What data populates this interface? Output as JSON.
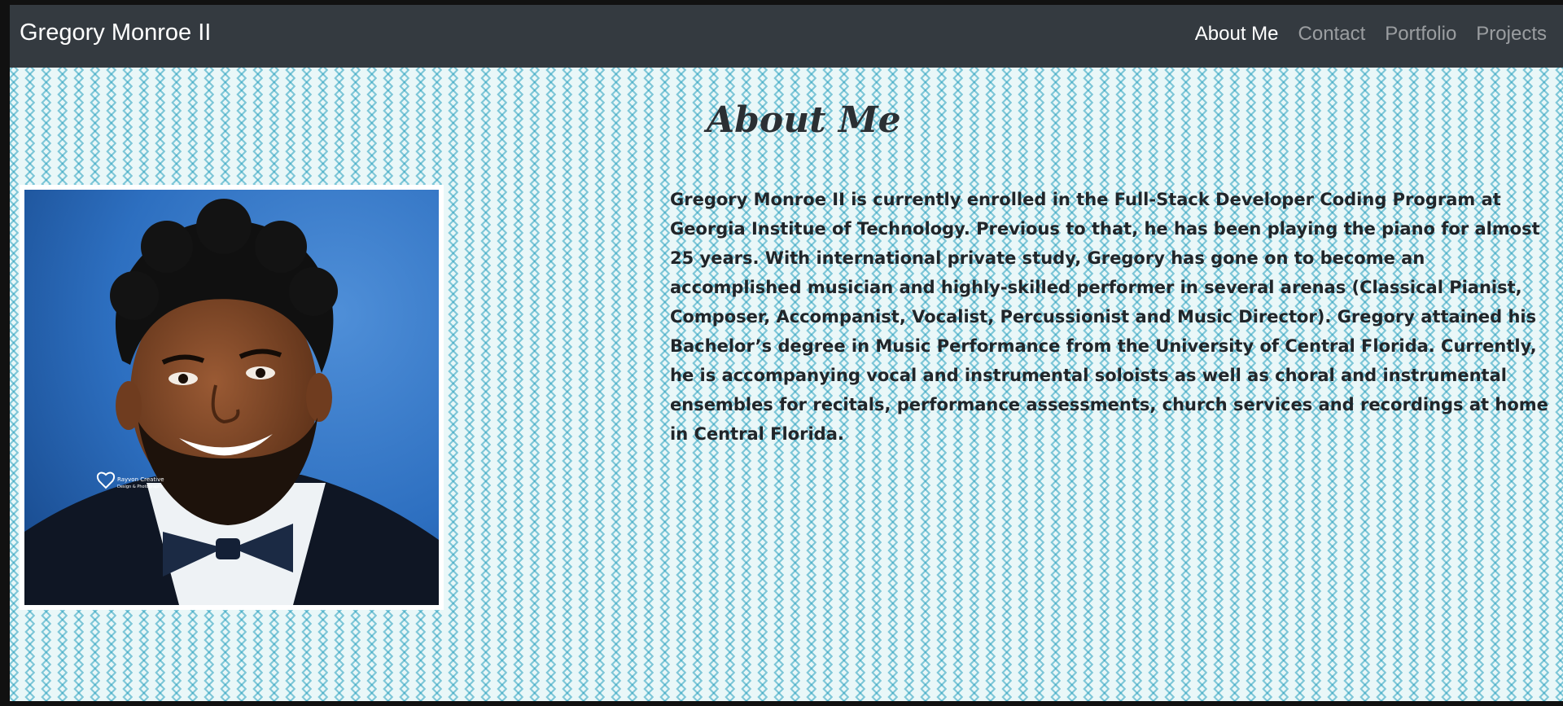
{
  "navbar": {
    "brand": "Gregory Monroe II",
    "links": [
      {
        "label": "About Me",
        "active": true
      },
      {
        "label": "Contact",
        "active": false
      },
      {
        "label": "Portfolio",
        "active": false
      },
      {
        "label": "Projects",
        "active": false
      }
    ]
  },
  "main": {
    "title": "About Me",
    "photo_icon": "portrait-photo",
    "photo_watermark": "Rayvon Creative Design & Photography",
    "bio": "Gregory Monroe II is currently enrolled in the Full-Stack Developer Coding Program at Georgia Institue of Technology. Previous to that, he has been playing the piano for almost 25 years. With international private study, Gregory has gone on to become an accomplished musician and highly-skilled performer in several arenas (Classical Pianist, Composer, Accompanist, Vocalist, Percussionist and Music Director). Gregory attained his Bachelor’s degree in Music Performance from the University of Central Florida. Currently, he is accompanying vocal and instrumental soloists as well as choral and instrumental ensembles for recitals, performance assessments, church services and recordings at home in Central Florida."
  },
  "colors": {
    "navbar_bg": "#343a40",
    "nav_active": "#ffffff",
    "nav_inactive": "rgba(255,255,255,0.5)",
    "pattern": "#28a0be",
    "text": "#212529"
  }
}
